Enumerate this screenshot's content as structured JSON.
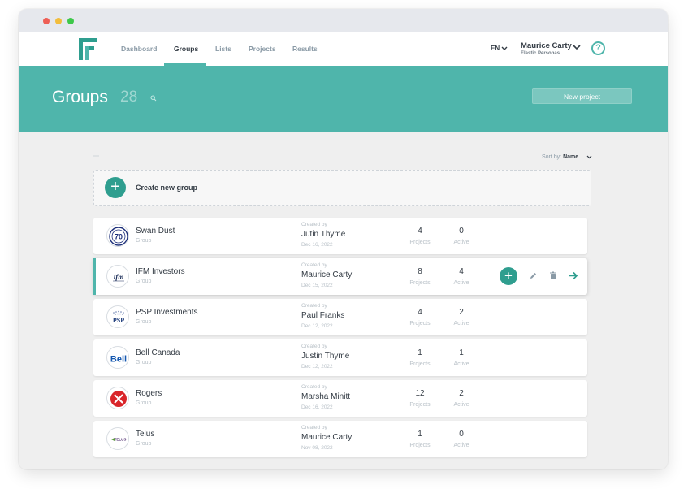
{
  "nav": {
    "items": [
      {
        "label": "Dashboard",
        "active": false
      },
      {
        "label": "Groups",
        "active": true
      },
      {
        "label": "Lists",
        "active": false
      },
      {
        "label": "Projects",
        "active": false
      },
      {
        "label": "Results",
        "active": false
      }
    ],
    "lang": "EN",
    "user_name": "Maurice Carty",
    "user_org": "Elastic Personas",
    "help": "?"
  },
  "banner": {
    "title": "Groups",
    "count": "28",
    "new_project_label": "New project"
  },
  "toolbar": {
    "sort_prefix": "Sort by:",
    "sort_value": "Name"
  },
  "create": {
    "label": "Create new group",
    "plus": "+"
  },
  "colors": {
    "accent": "#4fb5ab",
    "accent_dark": "#2f9e8f",
    "text": "#333b44",
    "muted": "#b8c0c7"
  },
  "groups": [
    {
      "name": "Swan Dust",
      "type": "Group",
      "created_by_label": "Created by",
      "creator": "Jutin Thyme",
      "date": "Dec 16, 2022",
      "projects": "4",
      "projects_label": "Projects",
      "active": "0",
      "active_label": "Active",
      "logo": "swan-dust-logo"
    },
    {
      "name": "IFM Investors",
      "type": "Group",
      "created_by_label": "Created by",
      "creator": "Maurice Carty",
      "date": "Dec 15, 2022",
      "projects": "8",
      "projects_label": "Projects",
      "active": "4",
      "active_label": "Active",
      "logo": "ifm-logo",
      "selected": true
    },
    {
      "name": "PSP Investments",
      "type": "Group",
      "created_by_label": "Created by",
      "creator": "Paul Franks",
      "date": "Dec 12, 2022",
      "projects": "4",
      "projects_label": "Projects",
      "active": "2",
      "active_label": "Active",
      "logo": "psp-logo"
    },
    {
      "name": "Bell Canada",
      "type": "Group",
      "created_by_label": "Created by",
      "creator": "Justin Thyme",
      "date": "Dec 12, 2022",
      "projects": "1",
      "projects_label": "Projects",
      "active": "1",
      "active_label": "Active",
      "logo": "bell-logo"
    },
    {
      "name": "Rogers",
      "type": "Group",
      "created_by_label": "Created by",
      "creator": "Marsha Minitt",
      "date": "Dec 16, 2022",
      "projects": "12",
      "projects_label": "Projects",
      "active": "2",
      "active_label": "Active",
      "logo": "rogers-logo"
    },
    {
      "name": "Telus",
      "type": "Group",
      "created_by_label": "Created by",
      "creator": "Maurice Carty",
      "date": "Nov 08, 2022",
      "projects": "1",
      "projects_label": "Projects",
      "active": "0",
      "active_label": "Active",
      "logo": "telus-logo"
    }
  ],
  "row_actions": {
    "add": "+"
  },
  "logos": {
    "ifm": "ifm",
    "psp": "PSP",
    "bell": "Bell",
    "swan": "70",
    "telus": "TELUS"
  }
}
